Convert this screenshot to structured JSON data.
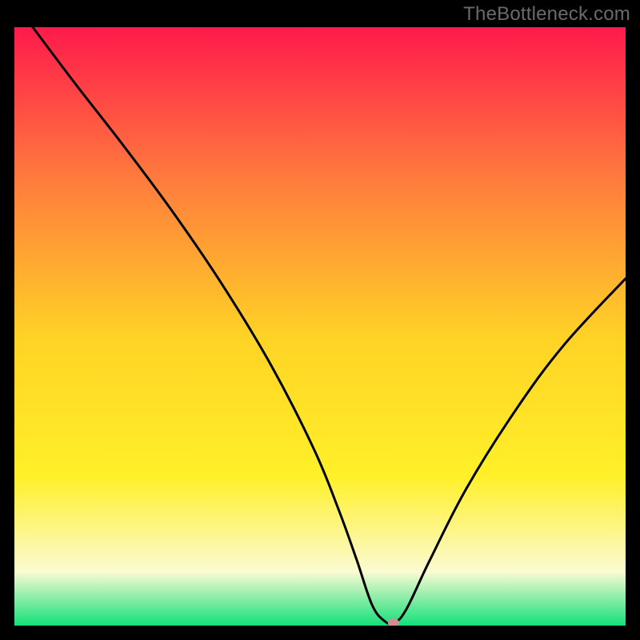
{
  "watermark": "TheBottleneck.com",
  "chart_data": {
    "type": "line",
    "title": "",
    "xlabel": "",
    "ylabel": "",
    "xlim": [
      0,
      100
    ],
    "ylim": [
      0,
      100
    ],
    "x": [
      3,
      10,
      18,
      26,
      34,
      42,
      49,
      53,
      56,
      58.5,
      60.5,
      62,
      64,
      68,
      74,
      82,
      90,
      100
    ],
    "values": [
      100,
      90.5,
      80,
      69,
      57,
      43.5,
      29.5,
      19.5,
      11,
      3.5,
      0.8,
      0.5,
      2.5,
      11,
      23,
      36,
      47,
      58
    ],
    "marker": {
      "x": 62,
      "y": 0.5,
      "color": "#d68b8f"
    },
    "series_color": "#000000",
    "background_gradient": {
      "top": "#ff1a4b",
      "upper_mid": "#ff7a3d",
      "mid": "#ffd326",
      "lower_mid": "#fff028",
      "pale_band": "#fbfad2",
      "bottom": "#13e07a"
    }
  }
}
